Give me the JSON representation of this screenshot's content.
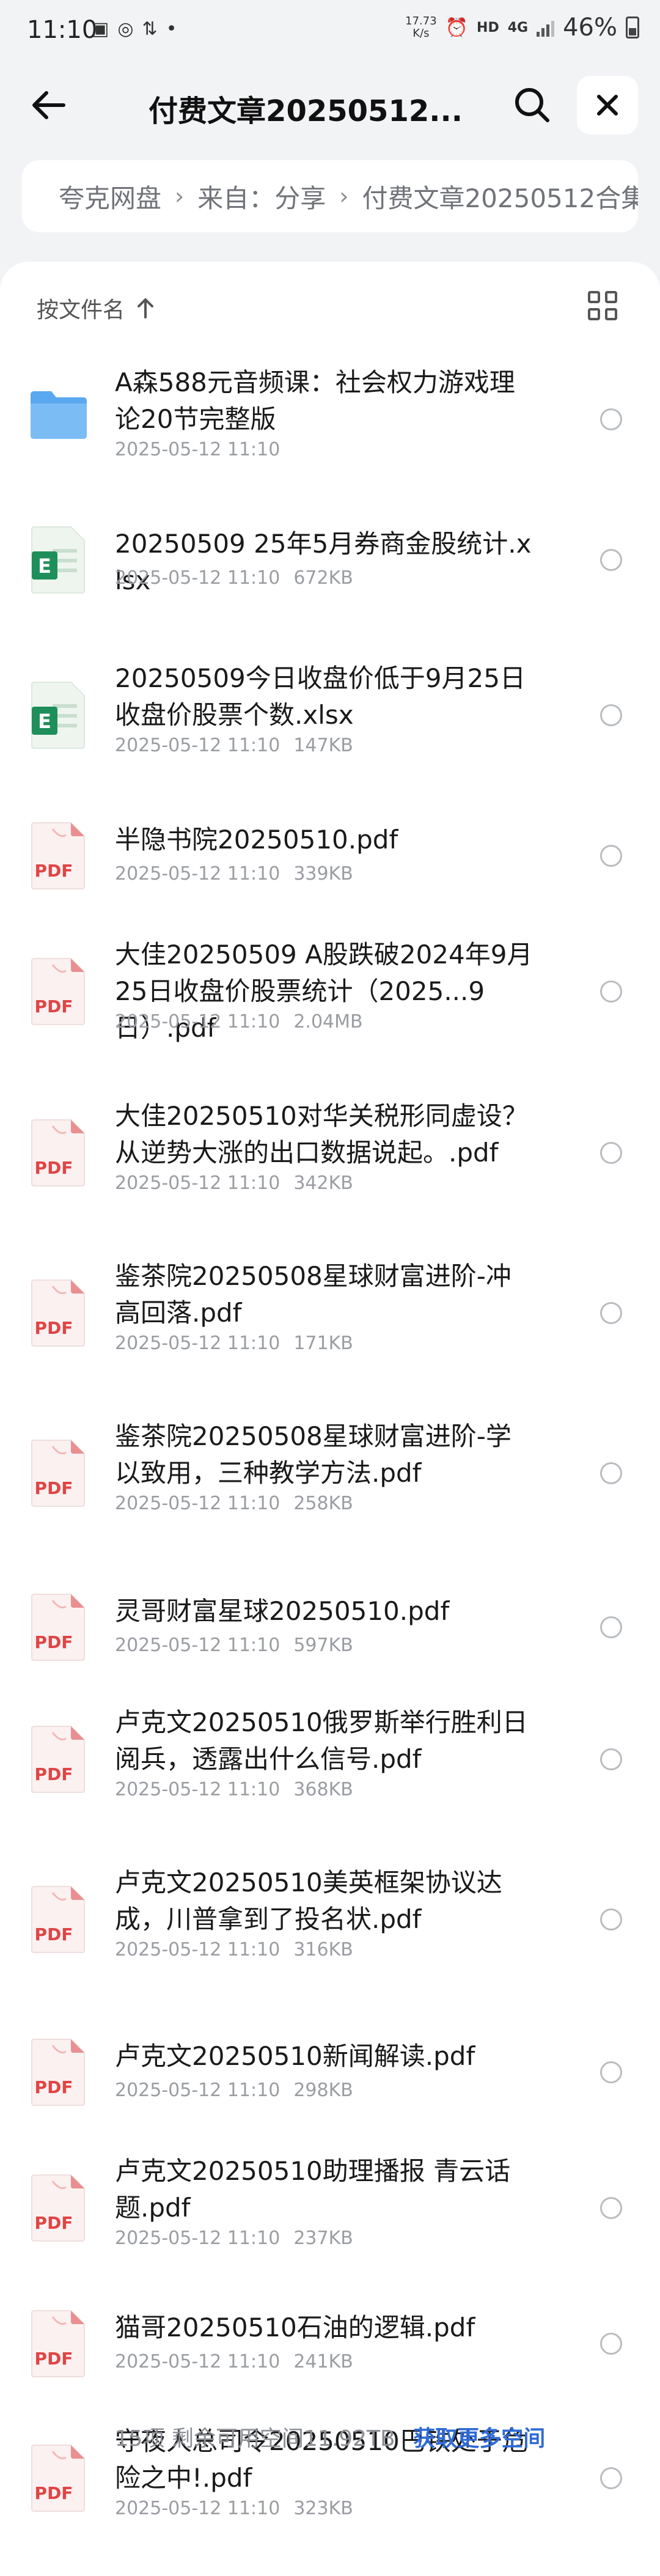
{
  "status_bar": {
    "time": "11:10",
    "speed_value": "17.73",
    "speed_unit": "K/s",
    "hd_label": "HD",
    "network_label": "4G",
    "battery": "46%"
  },
  "header": {
    "title": "付费文章20250512..."
  },
  "breadcrumb": {
    "items": [
      "夸克网盘",
      "来自：分享",
      "付费文章20250512合集"
    ]
  },
  "sort": {
    "label": "按文件名"
  },
  "files": [
    {
      "type": "folder",
      "name": "A森588元音频课：社会权力游戏理论20节完整版",
      "date": "2025-05-12 11:10",
      "size": ""
    },
    {
      "type": "xlsx",
      "name": "20250509 25年5月券商金股统计.xlsx",
      "date": "2025-05-12 11:10",
      "size": "672KB"
    },
    {
      "type": "xlsx",
      "name": "20250509今日收盘价低于9月25日收盘价股票个数.xlsx",
      "date": "2025-05-12 11:10",
      "size": "147KB"
    },
    {
      "type": "pdf",
      "name": "半隐书院20250510.pdf",
      "date": "2025-05-12 11:10",
      "size": "339KB"
    },
    {
      "type": "pdf",
      "name": "大佳20250509 A股跌破2024年9月25日收盘价股票统计（2025...9日）.pdf",
      "date": "2025-05-12 11:10",
      "size": "2.04MB"
    },
    {
      "type": "pdf",
      "name": "大佳20250510对华关税形同虚设？从逆势大涨的出口数据说起。.pdf",
      "date": "2025-05-12 11:10",
      "size": "342KB"
    },
    {
      "type": "pdf",
      "name": "鉴茶院20250508星球财富进阶-冲高回落.pdf",
      "date": "2025-05-12 11:10",
      "size": "171KB"
    },
    {
      "type": "pdf",
      "name": "鉴茶院20250508星球财富进阶-学以致用，三种教学方法.pdf",
      "date": "2025-05-12 11:10",
      "size": "258KB"
    },
    {
      "type": "pdf",
      "name": "灵哥财富星球20250510.pdf",
      "date": "2025-05-12 11:10",
      "size": "597KB"
    },
    {
      "type": "pdf",
      "name": "卢克文20250510俄罗斯举行胜利日阅兵，透露出什么信号.pdf",
      "date": "2025-05-12 11:10",
      "size": "368KB"
    },
    {
      "type": "pdf",
      "name": "卢克文20250510美英框架协议达成，川普拿到了投名状.pdf",
      "date": "2025-05-12 11:10",
      "size": "316KB"
    },
    {
      "type": "pdf",
      "name": "卢克文20250510新闻解读.pdf",
      "date": "2025-05-12 11:10",
      "size": "298KB"
    },
    {
      "type": "pdf",
      "name": "卢克文20250510助理播报 青云话题.pdf",
      "date": "2025-05-12 11:10",
      "size": "237KB"
    },
    {
      "type": "pdf",
      "name": "猫哥20250510石油的逻辑.pdf",
      "date": "2025-05-12 11:10",
      "size": "241KB"
    },
    {
      "type": "pdf",
      "name": "守夜人总司令20250510巴铁处于危险之中!.pdf",
      "date": "2025-05-12 11:10",
      "size": "323KB"
    }
  ],
  "footer": {
    "summary": "15项 剩余可用空间11.92TB",
    "link": "获取更多空间"
  },
  "icons": {
    "pdf_label": "PDF",
    "xlsx_label": "E"
  },
  "colors": {
    "accent": "#2f6bd6",
    "folder": "#5aa8f0",
    "xlsx": "#1e8f5a",
    "pdf": "#e04545"
  }
}
